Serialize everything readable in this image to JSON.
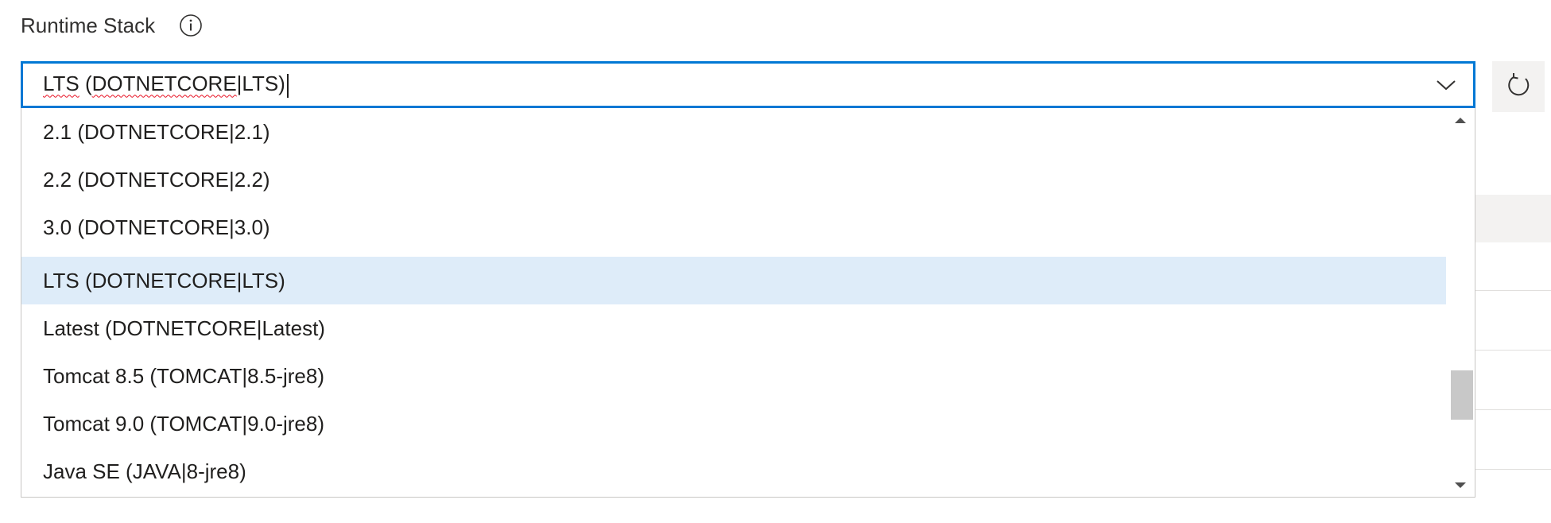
{
  "field": {
    "label": "Runtime Stack",
    "info_icon": "info-icon"
  },
  "combobox": {
    "value_prefix": "LTS",
    "value_middle": " (",
    "value_squiggle": "DOTNETCORE",
    "value_suffix": "|LTS)",
    "chevron_icon": "chevron-down-icon"
  },
  "refresh": {
    "icon": "refresh-icon"
  },
  "dropdown": {
    "options": [
      {
        "label": "2.1 (DOTNETCORE|2.1)",
        "selected": false
      },
      {
        "label": "2.2 (DOTNETCORE|2.2)",
        "selected": false
      },
      {
        "label": "3.0 (DOTNETCORE|3.0)",
        "selected": false
      },
      {
        "label": "LTS (DOTNETCORE|LTS)",
        "selected": true
      },
      {
        "label": "Latest (DOTNETCORE|Latest)",
        "selected": false
      },
      {
        "label": "Tomcat 8.5 (TOMCAT|8.5-jre8)",
        "selected": false
      },
      {
        "label": "Tomcat 9.0 (TOMCAT|9.0-jre8)",
        "selected": false
      },
      {
        "label": "Java SE (JAVA|8-jre8)",
        "selected": false
      }
    ],
    "scroll_up_icon": "scroll-up-arrow-icon",
    "scroll_down_icon": "scroll-down-arrow-icon"
  },
  "colors": {
    "focus_border": "#0078d4",
    "selected_bg": "#deecf9",
    "spell_error": "#e81123"
  }
}
